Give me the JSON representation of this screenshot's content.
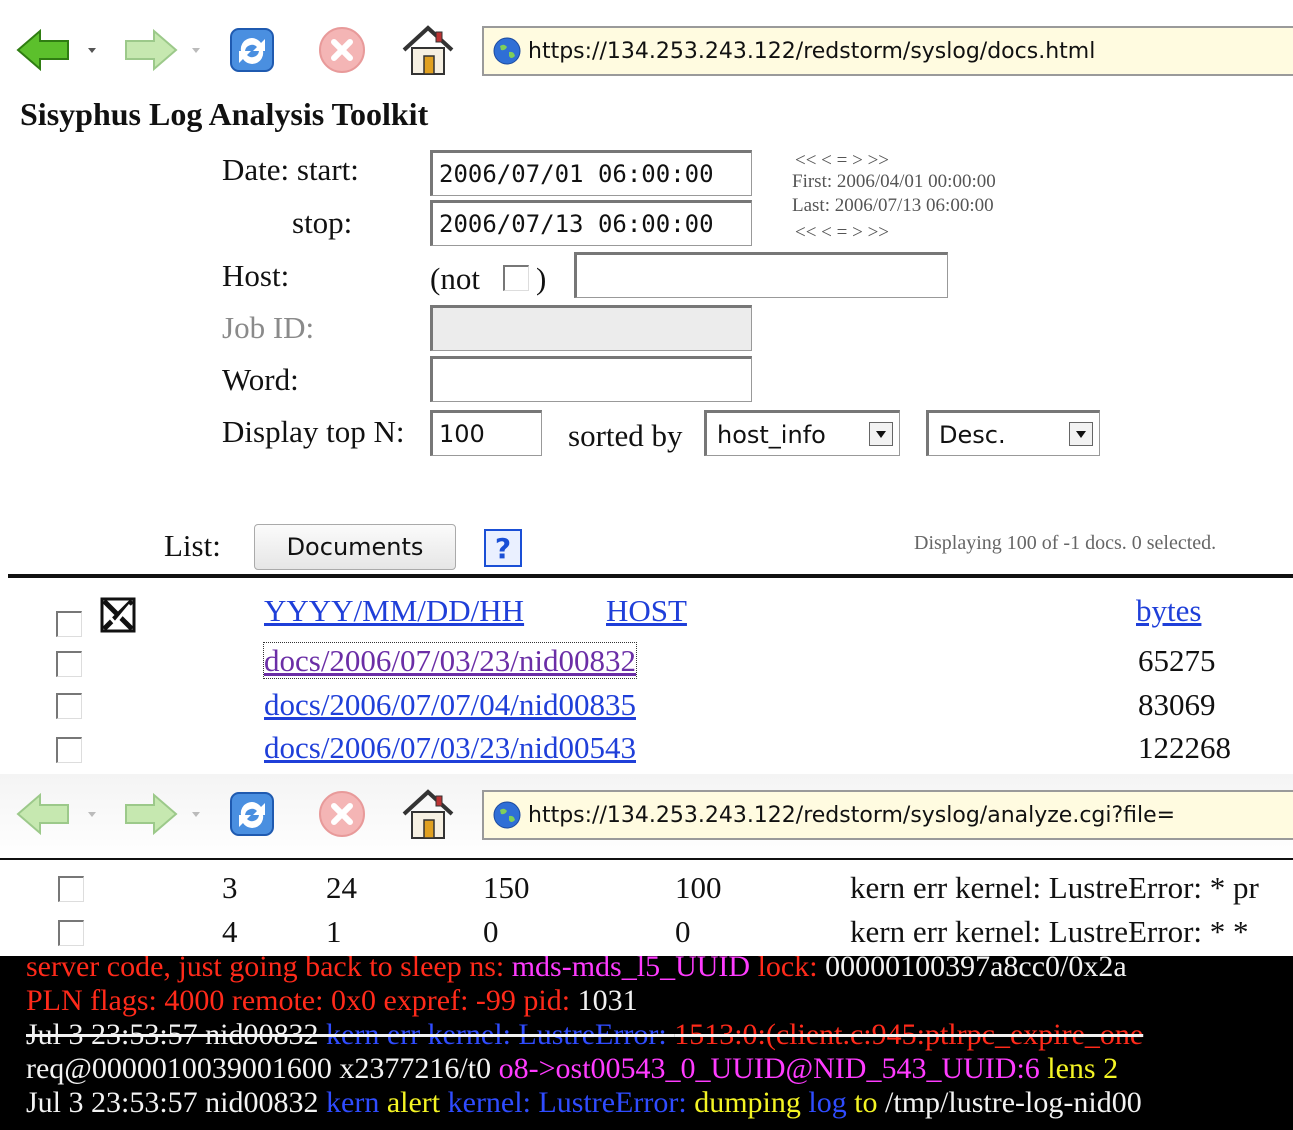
{
  "window1": {
    "url": "https://134.253.243.122/redstorm/syslog/docs.html",
    "app_title": "Sisyphus Log Analysis Toolkit",
    "form": {
      "date_label": "Date: start:",
      "stop_label": "stop:",
      "start_value": "2006/07/01 06:00:00",
      "stop_value": "2006/07/13 06:00:00",
      "nav_top": "<<    <    =    >    >>",
      "first_text": "First: 2006/04/01 00:00:00",
      "last_text": "Last: 2006/07/13 06:00:00",
      "nav_bottom": "<<    <    =    >    >>",
      "host_label": "Host:",
      "not_open": "(not",
      "not_close": ")",
      "host_value": "",
      "jobid_label": "Job ID:",
      "jobid_value": "",
      "word_label": "Word:",
      "word_value": "",
      "topn_label": "Display top N:",
      "topn_value": "100",
      "sorted_label": "sorted by",
      "sort_field": "host_info",
      "sort_order": "Desc."
    },
    "list": {
      "label": "List:",
      "documents_button": "Documents",
      "help_icon_text": "?",
      "status": "Displaying 100 of -1 docs. 0 selected."
    },
    "table": {
      "headers": {
        "date": "YYYY/MM/DD/HH",
        "host": "HOST",
        "bytes": "bytes"
      },
      "select_all_checked": true,
      "rows": [
        {
          "doc": "docs/2006/07/03/23/nid00832",
          "bytes": "65275"
        },
        {
          "doc": "docs/2006/07/07/04/nid00835",
          "bytes": "83069"
        },
        {
          "doc": "docs/2006/07/03/23/nid00543",
          "bytes": "122268"
        }
      ]
    }
  },
  "window2": {
    "url": "https://134.253.243.122/redstorm/syslog/analyze.cgi?file=",
    "rows": [
      {
        "c1": "3",
        "c2": "24",
        "c3": "150",
        "c4": "100",
        "msg": "kern err kernel: LustreError: * pr"
      },
      {
        "c1": "4",
        "c2": "1",
        "c3": "0",
        "c4": "0",
        "msg": "kern err kernel: LustreError: * *"
      }
    ],
    "log": {
      "l1_a": "server code, just going back to sleep ns: ",
      "l1_b": "mds-mds_l5_UUID",
      "l1_c": " lock: ",
      "l1_d": "00000100397a8cc0/0x2a",
      "l2_a": "PLN flags: ",
      "l2_b": "4000",
      "l2_c": " remote: ",
      "l2_d": "0x0",
      "l2_e": " expref: ",
      "l2_f": "-99",
      "l2_g": " pid: ",
      "l2_h": "1031",
      "l3_a": "Jul 3 23:53:57 nid00832 ",
      "l3_b": "kern err kernel: LustreError: ",
      "l3_c": "1513:0:(client.c:945:ptlrpc_expire_one",
      "l4_a": "req@0000010039001600 x2377216/t0 ",
      "l4_b": "o8->ost00543_0_UUID@NID_543_UUID:6",
      "l4_c": " lens 2",
      "l5_a": "Jul 3 23:53:57 nid00832 ",
      "l5_b": "kern ",
      "l5_c": "alert ",
      "l5_d": "kernel: LustreError: ",
      "l5_e": "dumping ",
      "l5_f": "log ",
      "l5_g": "to ",
      "l5_h": "/tmp/lustre-log-nid00"
    }
  },
  "icons": {
    "back": "back-arrow-icon",
    "forward": "forward-arrow-icon",
    "reload": "reload-icon",
    "stop": "stop-icon",
    "home": "home-icon",
    "site": "globe-icon"
  },
  "colors": {
    "link": "#1f3fd9",
    "visited": "#6b2ea6",
    "terminal_bg": "#000000",
    "term_red": "#ff2a1a",
    "term_magenta": "#ff3cff",
    "term_blue": "#2f4cff",
    "term_yellow": "#f4f424"
  }
}
